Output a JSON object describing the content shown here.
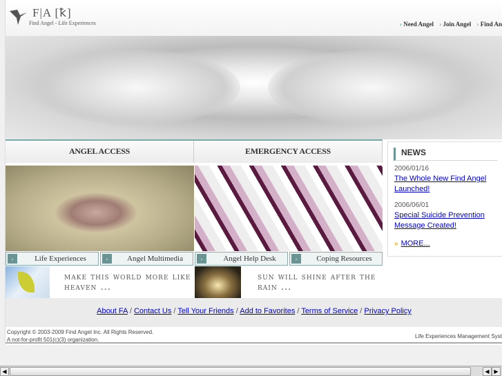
{
  "header": {
    "logo_text": "F|A [ꝁ]",
    "logo_sub": "Find Angel - Life Experiences",
    "nav": [
      "Need Angel",
      "Join Angel",
      "Find Angel"
    ]
  },
  "access": {
    "tabs": [
      "ANGEL ACCESS",
      "EMERGENCY ACCESS"
    ]
  },
  "sections": [
    "Life Experiences",
    "Angel Multimedia",
    "Angel Help Desk",
    "Coping Resources"
  ],
  "quotes": [
    "make this world more like heaven ...",
    "sun will shine after the rain ..."
  ],
  "news": {
    "title": "NEWS",
    "items": [
      {
        "date": "2006/01/16",
        "headline": "The Whole New Find Angel Launched!"
      },
      {
        "date": "2006/06/01",
        "headline": "Special Suicide Prevention Message Created!"
      }
    ],
    "more": "MORE..."
  },
  "footer": {
    "links": [
      "About FA",
      "Contact Us",
      "Tell Your Friends",
      "Add to Favorites",
      "Terms of Service",
      "Privacy Policy"
    ],
    "copyright": "Copyright © 2003-2009 Find Angel Inc. All Rights Reserved.",
    "nonprofit": "A not-for-profit 501(c)(3) organization.",
    "system": "Life Experiences Management System"
  }
}
